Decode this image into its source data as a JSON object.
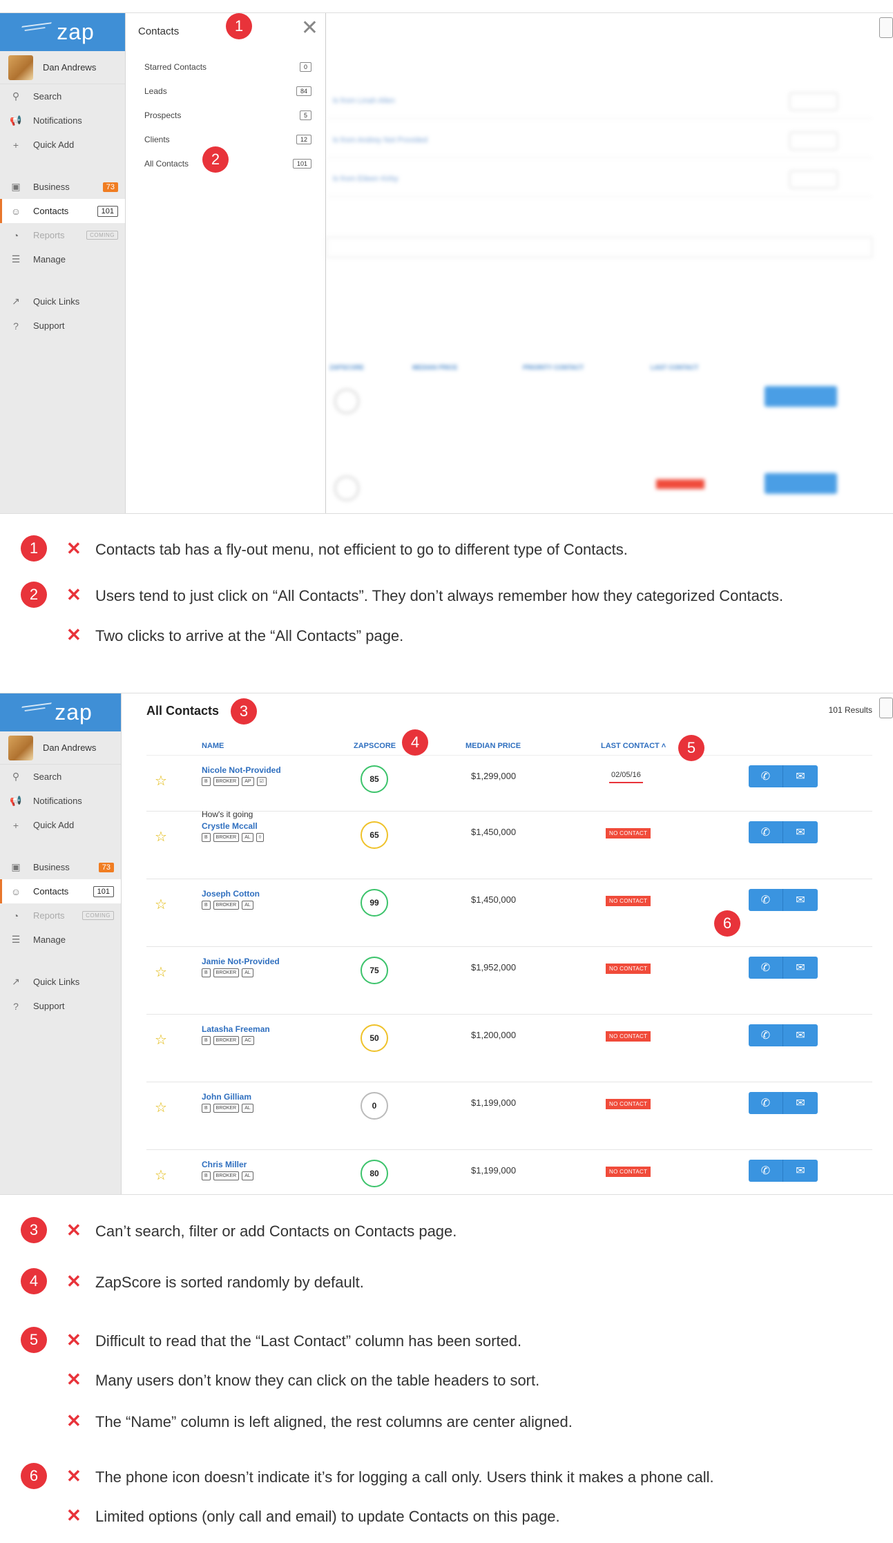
{
  "app": {
    "logo": "zap",
    "user_name": "Dan Andrews"
  },
  "nav": [
    {
      "label": "Search",
      "icon": "search-icon",
      "glyph": "⚲"
    },
    {
      "label": "Notifications",
      "icon": "megaphone-icon",
      "glyph": "📢"
    },
    {
      "label": "Quick Add",
      "icon": "plus-icon",
      "glyph": "+"
    },
    {
      "label": "Business",
      "icon": "briefcase-icon",
      "glyph": "▣",
      "badge": "73"
    },
    {
      "label": "Contacts",
      "icon": "person-icon",
      "glyph": "☺",
      "badge": "101"
    },
    {
      "label": "Reports",
      "icon": "pie-chart-icon",
      "glyph": "◔",
      "badge": "COMING"
    },
    {
      "label": "Manage",
      "icon": "sliders-icon",
      "glyph": "☰"
    },
    {
      "label": "Quick Links",
      "icon": "external-link-icon",
      "glyph": "↗"
    },
    {
      "label": "Support",
      "icon": "help-icon",
      "glyph": "?"
    }
  ],
  "flyout": {
    "title": "Contacts",
    "items": [
      {
        "label": "Starred Contacts",
        "count": "0"
      },
      {
        "label": "Leads",
        "count": "84"
      },
      {
        "label": "Prospects",
        "count": "5"
      },
      {
        "label": "Clients",
        "count": "12"
      },
      {
        "label": "All Contacts",
        "count": "101"
      }
    ]
  },
  "contacts_page": {
    "title": "All Contacts",
    "results": "101 Results",
    "headers": {
      "name": "NAME",
      "zapscore": "ZAPSCORE",
      "median_price": "MEDIAN PRICE",
      "last_contact": "LAST CONTACT ˄"
    },
    "rows": [
      {
        "name": "Nicole Not-Provided",
        "tags": [
          "B",
          "BROKER",
          "AP",
          "☑"
        ],
        "score": "85",
        "level": "high",
        "price": "$1,299,000",
        "last_contact": "02/05/16",
        "note": "How's it going"
      },
      {
        "name": "Crystle Mccall",
        "tags": [
          "B",
          "BROKER",
          "AL",
          "◊"
        ],
        "score": "65",
        "level": "mid",
        "price": "$1,450,000",
        "last_contact": "NO CONTACT"
      },
      {
        "name": "Joseph Cotton",
        "tags": [
          "B",
          "BROKER",
          "AL"
        ],
        "score": "99",
        "level": "high",
        "price": "$1,450,000",
        "last_contact": "NO CONTACT"
      },
      {
        "name": "Jamie Not-Provided",
        "tags": [
          "B",
          "BROKER",
          "AL"
        ],
        "score": "75",
        "level": "high",
        "price": "$1,952,000",
        "last_contact": "NO CONTACT"
      },
      {
        "name": "Latasha Freeman",
        "tags": [
          "B",
          "BROKER",
          "AC"
        ],
        "score": "50",
        "level": "mid",
        "price": "$1,200,000",
        "last_contact": "NO CONTACT"
      },
      {
        "name": "John Gilliam",
        "tags": [
          "B",
          "BROKER",
          "AL"
        ],
        "score": "0",
        "level": "none",
        "price": "$1,199,000",
        "last_contact": "NO CONTACT"
      },
      {
        "name": "Chris Miller",
        "tags": [
          "B",
          "BROKER",
          "AL"
        ],
        "score": "80",
        "level": "high",
        "price": "$1,199,000",
        "last_contact": "NO CONTACT"
      }
    ]
  },
  "annotations": {
    "n1": "1",
    "n2": "2",
    "n3": "3",
    "n4": "4",
    "n5": "5",
    "n6": "6",
    "a1": "Contacts tab has a fly-out menu, not efficient to go to different type of Contacts.",
    "a2a": "Users tend to just click on “All Contacts”. They don’t always remember how they categorized Contacts.",
    "a2b": "Two clicks to arrive at the “All Contacts” page.",
    "a3": "Can’t search, filter or add Contacts on Contacts page.",
    "a4": "ZapScore is sorted randomly by default.",
    "a5a": "Difficult to read that the “Last Contact” column has been sorted.",
    "a5b": "Many users don’t know they can click on the table headers to sort.",
    "a5c": "The “Name” column is left aligned, the rest columns are center aligned.",
    "a6a": "The phone icon doesn’t indicate it’s for logging a call only. Users think it makes a phone call.",
    "a6b": "Limited options (only call and email) to update Contacts on this page."
  },
  "colors": {
    "brand": "#3f8fd6",
    "accent": "#e8762b",
    "alert": "#e8333a",
    "button": "#3a94e0"
  }
}
